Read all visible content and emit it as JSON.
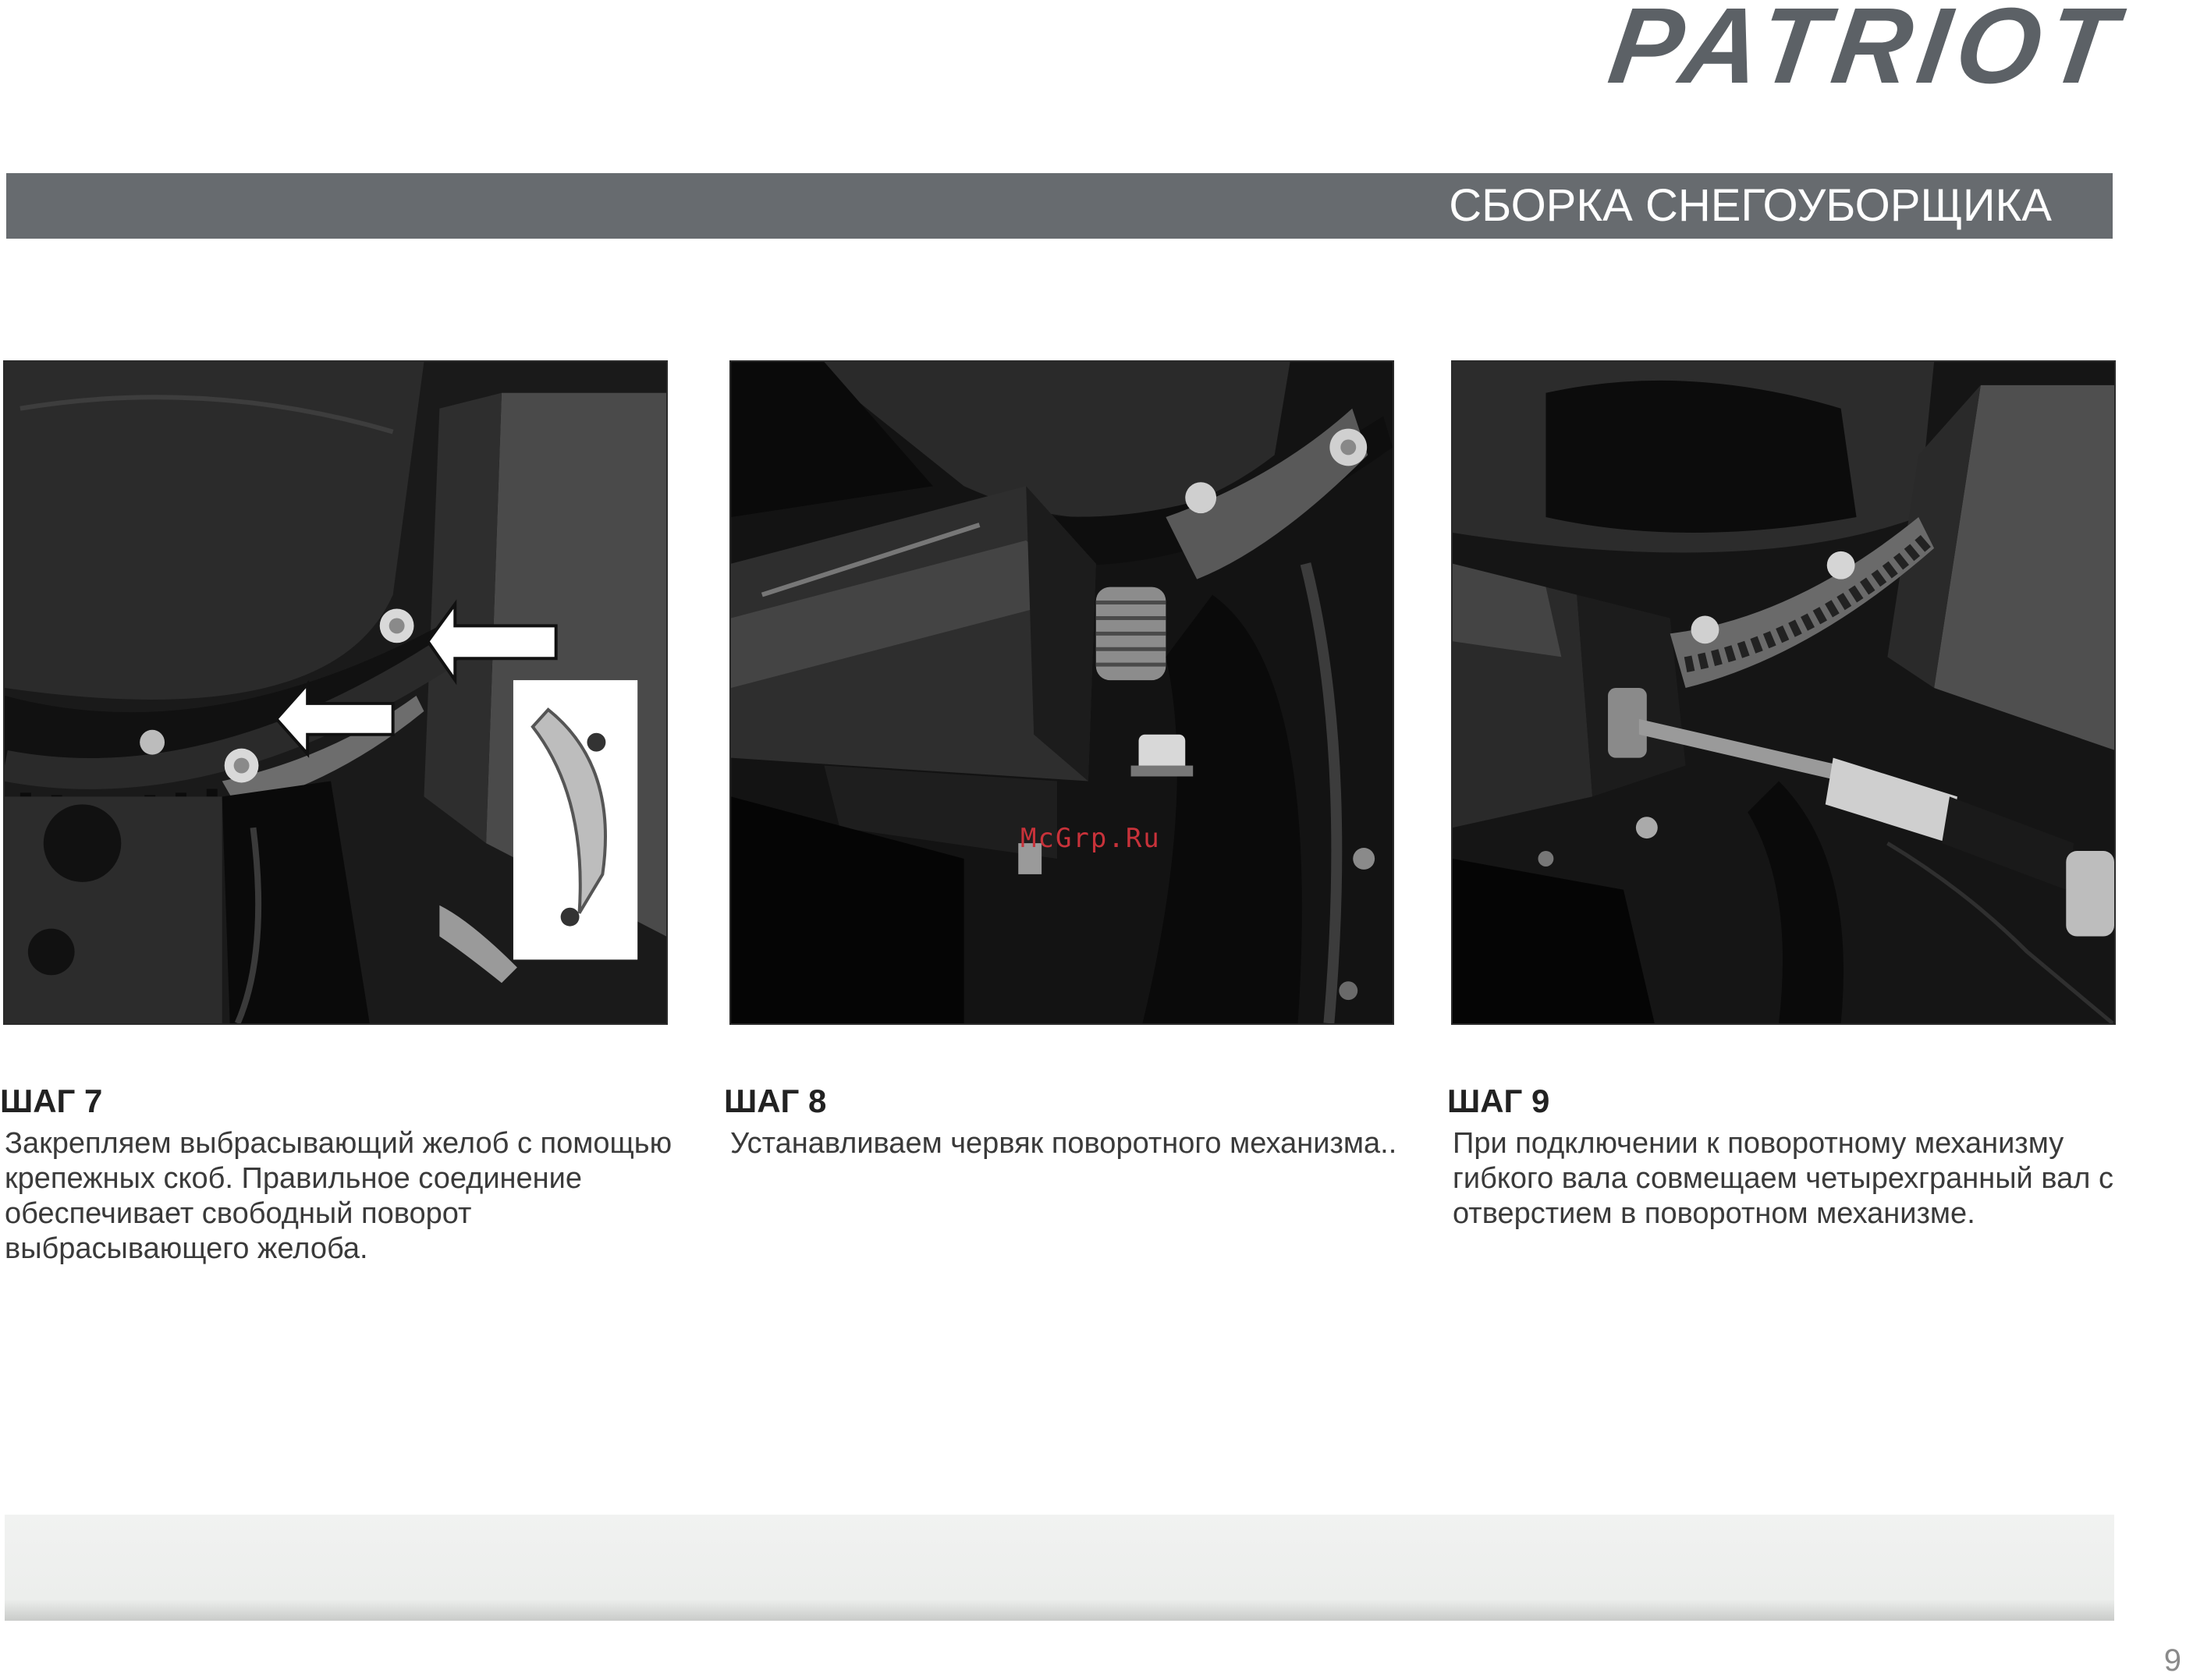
{
  "brand": {
    "logo_text": "PATRIOT"
  },
  "header": {
    "title": "СБОРКА СНЕГОУБОРЩИКА"
  },
  "steps": [
    {
      "title": "ШАГ 7",
      "text": "Закрепляем выбрасывающий желоб с помощью крепежных скоб. Правильное соединение обеспечивает свободный поворот выбрасывающего желоба."
    },
    {
      "title": "ШАГ 8",
      "text": "Устанавливаем червяк поворотного механизма.."
    },
    {
      "title": "ШАГ 9",
      "text": "При подключении к поворотному механизму гибкого вала совмещаем четырехгранный вал с отверстием в поворотном механизме."
    }
  ],
  "watermark": "McGrp.Ru",
  "page_number": "9"
}
